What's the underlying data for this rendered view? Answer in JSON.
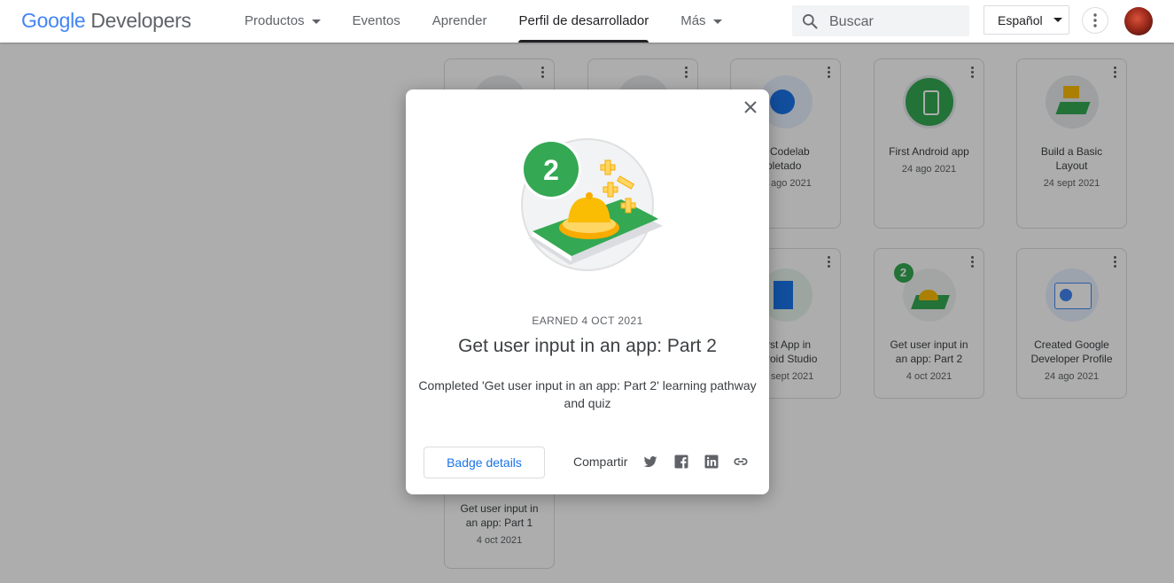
{
  "header": {
    "logo_google": "Google",
    "logo_developers": "Developers",
    "nav": [
      {
        "label": "Productos",
        "has_caret": true
      },
      {
        "label": "Eventos",
        "has_caret": false
      },
      {
        "label": "Aprender",
        "has_caret": false
      },
      {
        "label": "Perfil de desarrollador",
        "has_caret": false,
        "active": true
      },
      {
        "label": "Más",
        "has_caret": true
      }
    ],
    "search_placeholder": "Buscar",
    "language": "Español"
  },
  "badges": [
    {
      "title": "",
      "date": ""
    },
    {
      "title": "",
      "date": ""
    },
    {
      "title": "er Codelab\nmpletado",
      "date": "ago 2021"
    },
    {
      "title": "First Android app",
      "date": "24 ago 2021"
    },
    {
      "title": "Build a Basic\nLayout",
      "date": "24 sept 2021"
    },
    {
      "title": "rst App in\nroid Studio",
      "date": "sept 2021"
    },
    {
      "title": "Get user input in\nan app: Part 2",
      "date": "4 oct 2021"
    },
    {
      "title": "Created Google\nDeveloper Profile",
      "date": "24 ago 2021"
    },
    {
      "title": "Get user input in\nan app: Part 1",
      "date": "4 oct 2021"
    }
  ],
  "modal": {
    "badge_number": "2",
    "earned": "EARNED 4 OCT 2021",
    "title": "Get user input in an app: Part 2",
    "description": "Completed 'Get user input in an app: Part 2' learning pathway and quiz",
    "details_button": "Badge details",
    "share_label": "Compartir",
    "share_icons": [
      "twitter-icon",
      "facebook-icon",
      "linkedin-icon",
      "link-icon"
    ]
  },
  "colors": {
    "accent_blue": "#1a73e8",
    "badge_green": "#34a853",
    "scrim": "rgba(0,0,0,0.32)"
  }
}
